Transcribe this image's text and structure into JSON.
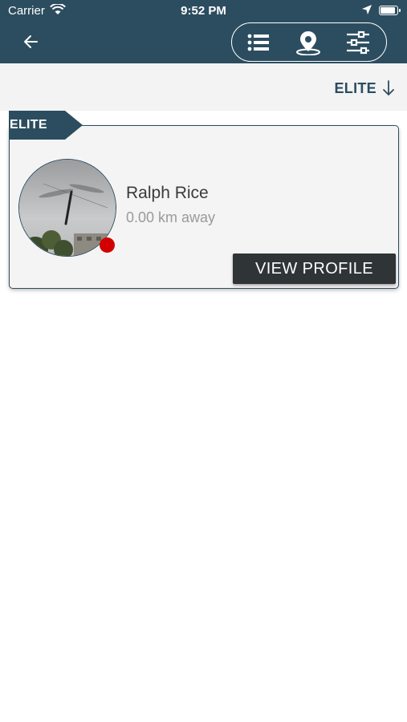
{
  "status_bar": {
    "carrier": "Carrier",
    "time": "9:52 PM"
  },
  "toolbar": {
    "back_icon": "back-arrow-icon",
    "segments": [
      "list-icon",
      "map-pin-icon",
      "filter-sliders-icon"
    ]
  },
  "sort": {
    "label": "ELITE",
    "icon": "arrow-down-icon"
  },
  "card": {
    "tag": "ELITE",
    "name": "Ralph Rice",
    "distance": "0.00 km away",
    "button": "VIEW PROFILE",
    "status_color": "#d20000"
  },
  "colors": {
    "accent": "#2c4d5f",
    "button": "#2f3436"
  }
}
